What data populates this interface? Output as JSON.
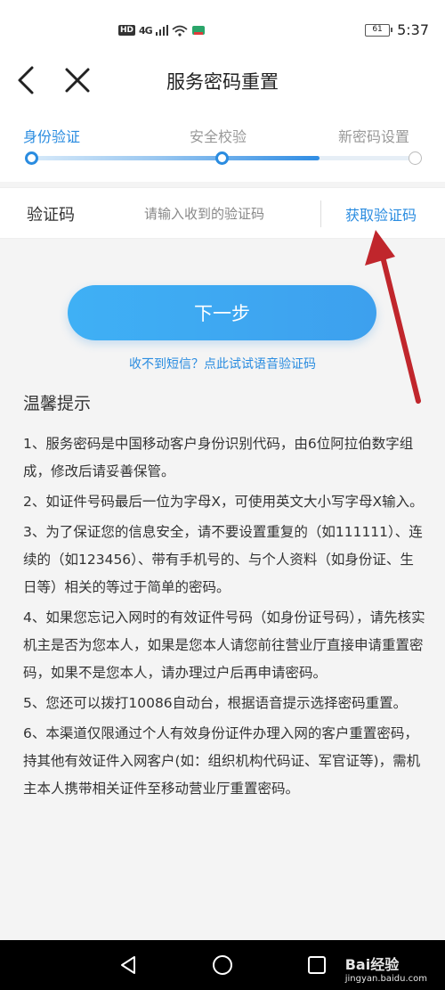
{
  "status_bar": {
    "hd": "HD",
    "network": "4G",
    "battery": "61",
    "time": "5:37"
  },
  "nav": {
    "title": "服务密码重置",
    "back_icon": "chevron-left-icon",
    "close_icon": "close-icon"
  },
  "steps": {
    "items": [
      {
        "label": "身份验证",
        "state": "done"
      },
      {
        "label": "安全校验",
        "state": "current"
      },
      {
        "label": "新密码设置",
        "state": "pending"
      }
    ],
    "progress_fraction": 0.75
  },
  "verify": {
    "label": "验证码",
    "placeholder": "请输入收到的验证码",
    "get_code": "获取验证码"
  },
  "next_button": "下一步",
  "voice_link": "收不到短信？点此试试语音验证码",
  "tips": {
    "title": "温馨提示",
    "items": [
      "1、服务密码是中国移动客户身份识别代码，由6位阿拉伯数字组成，修改后请妥善保管。",
      "2、如证件号码最后一位为字母X，可使用英文大小写字母X输入。",
      "3、为了保证您的信息安全，请不要设置重复的（如111111）、连续的（如123456）、带有手机号的、与个人资料（如身份证、生日等）相关的等过于简单的密码。",
      "4、如果您忘记入网时的有效证件号码（如身份证号码），请先核实机主是否为您本人，如果是您本人请您前往营业厅直接申请重置密码，如果不是您本人，请办理过户后再申请密码。",
      "5、您还可以拨打10086自动台，根据语音提示选择密码重置。",
      "6、本渠道仅限通过个人有效身份证件办理入网的客户重置密码，持其他有效证件入网客户(如：组织机构代码证、军官证等)，需机主本人携带相关证件至移动营业厅重置密码。"
    ]
  },
  "watermark": {
    "brand": "Bai经验",
    "url": "jingyan.baidu.com"
  },
  "colors": {
    "accent": "#2a8ce0",
    "button": "#3da8f2",
    "annotation_arrow": "#c0262c"
  }
}
